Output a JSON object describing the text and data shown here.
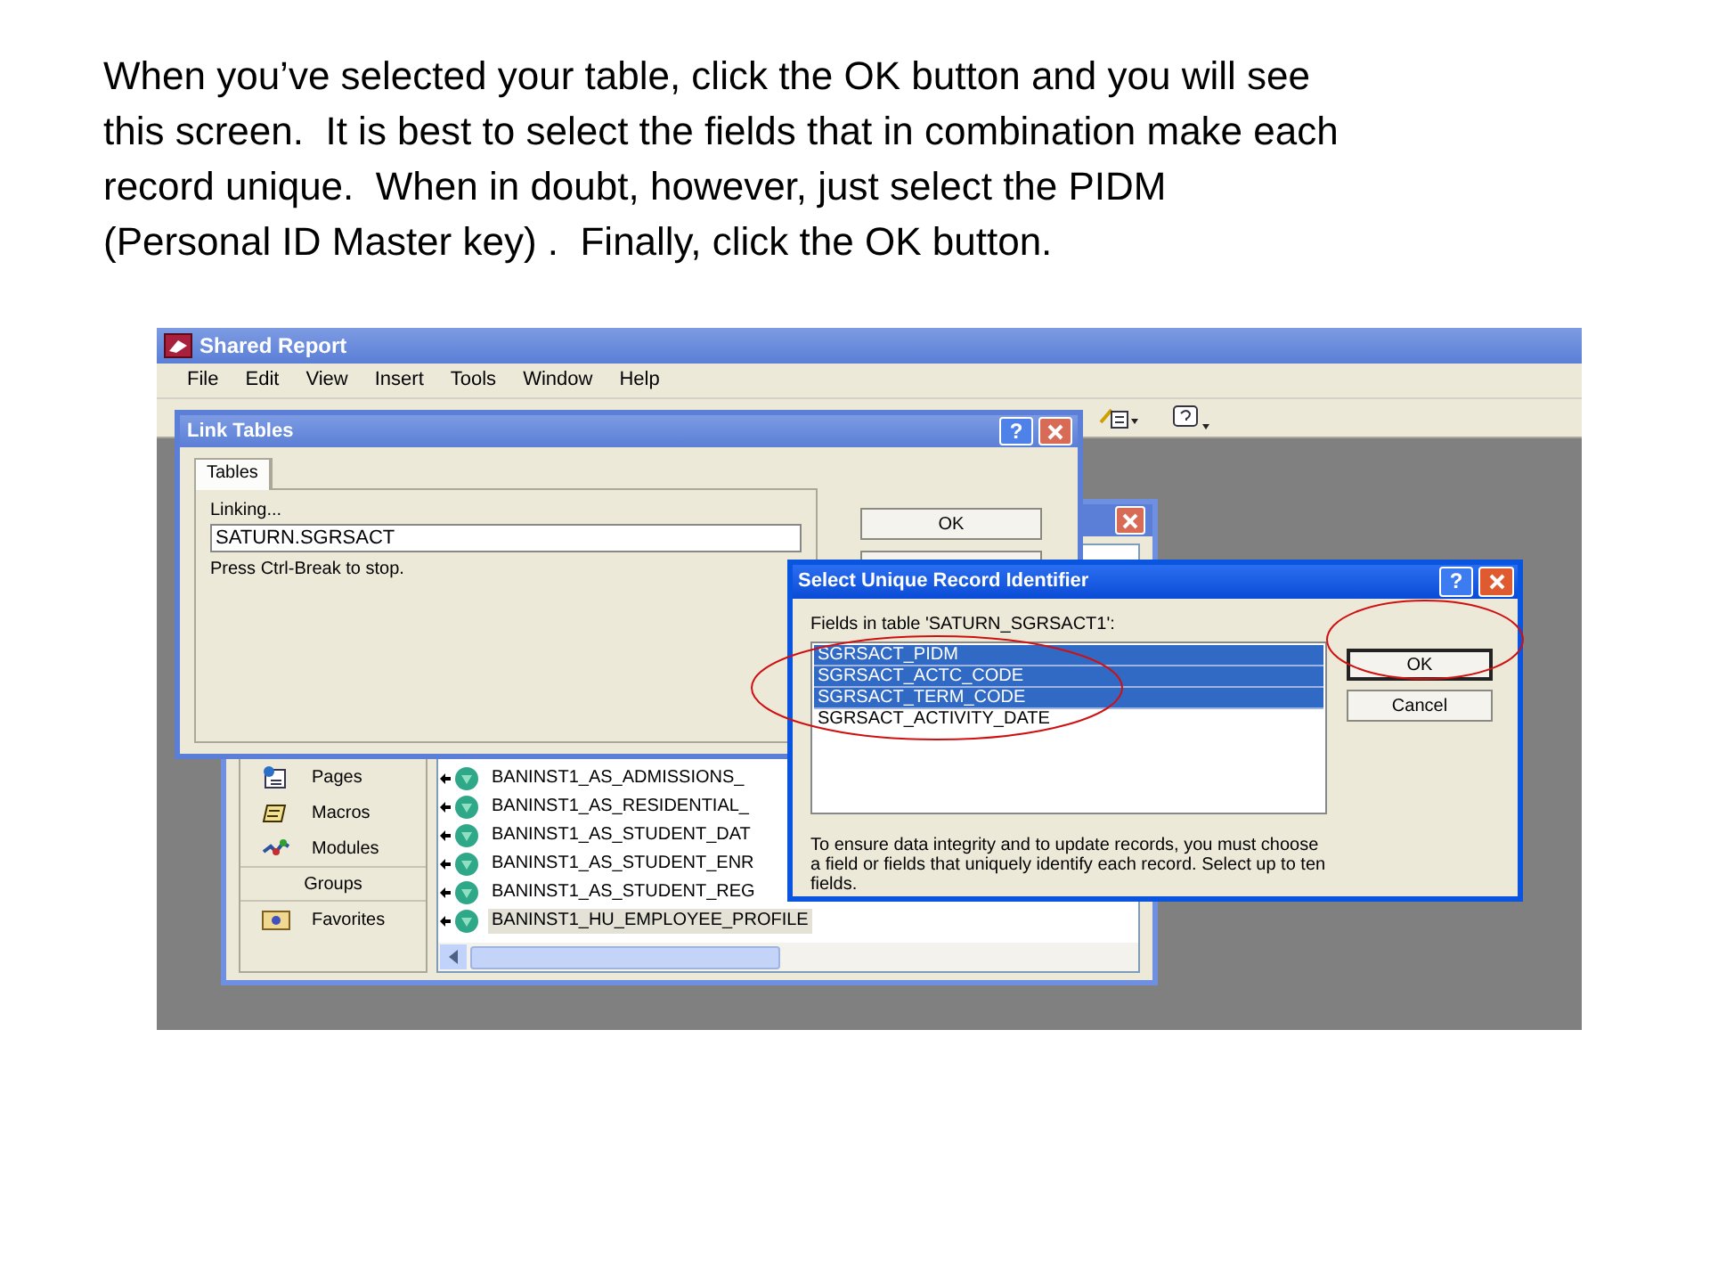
{
  "instructions": [
    "When you’ve selected your table, click the OK button and you will see",
    "this screen.  It is best to select the fields that in combination make each",
    "record unique.  When in doubt, however, just select the PIDM",
    "(Personal ID Master key) .  Finally, click the OK button."
  ],
  "window": {
    "title": "Shared Report"
  },
  "menu": [
    "File",
    "Edit",
    "View",
    "Insert",
    "Tools",
    "Window",
    "Help"
  ],
  "database_window": {
    "objects": [
      {
        "label": "Pages",
        "kind": "pages"
      },
      {
        "label": "Macros",
        "kind": "macros"
      },
      {
        "label": "Modules",
        "kind": "modules"
      }
    ],
    "groups_header": "Groups",
    "groups": [
      {
        "label": "Favorites"
      }
    ],
    "items": [
      {
        "label": "BANINST1_AS_ADMISSIONS_",
        "selected": false
      },
      {
        "label": "BANINST1_AS_RESIDENTIAL_",
        "selected": false
      },
      {
        "label": "BANINST1_AS_STUDENT_DAT",
        "selected": false
      },
      {
        "label": "BANINST1_AS_STUDENT_ENR",
        "selected": false
      },
      {
        "label": "BANINST1_AS_STUDENT_REG",
        "selected": false
      },
      {
        "label": "BANINST1_HU_EMPLOYEE_PROFILE",
        "selected": true
      }
    ]
  },
  "link_tables": {
    "title": "Link Tables",
    "help_button": "?",
    "tabs": [
      {
        "label": "Tables",
        "selected": true
      }
    ],
    "status_label": "Linking...",
    "current_table": "SATURN.SGRSACT",
    "hint": "Press Ctrl-Break to stop.",
    "ok_button": "OK"
  },
  "select_identifier": {
    "title": "Select Unique Record Identifier",
    "help_button": "?",
    "fields_label": "Fields in table 'SATURN_SGRSACT1':",
    "fields": [
      {
        "label": "SGRSACT_PIDM",
        "selected": true
      },
      {
        "label": "SGRSACT_ACTC_CODE",
        "selected": true
      },
      {
        "label": "SGRSACT_TERM_CODE",
        "selected": true
      },
      {
        "label": "SGRSACT_ACTIVITY_DATE",
        "selected": false
      }
    ],
    "buttons": [
      "OK",
      "Cancel"
    ],
    "note": "To ensure data integrity and to update records, you must choose a field or fields that uniquely identify each record. Select up to ten fields."
  }
}
